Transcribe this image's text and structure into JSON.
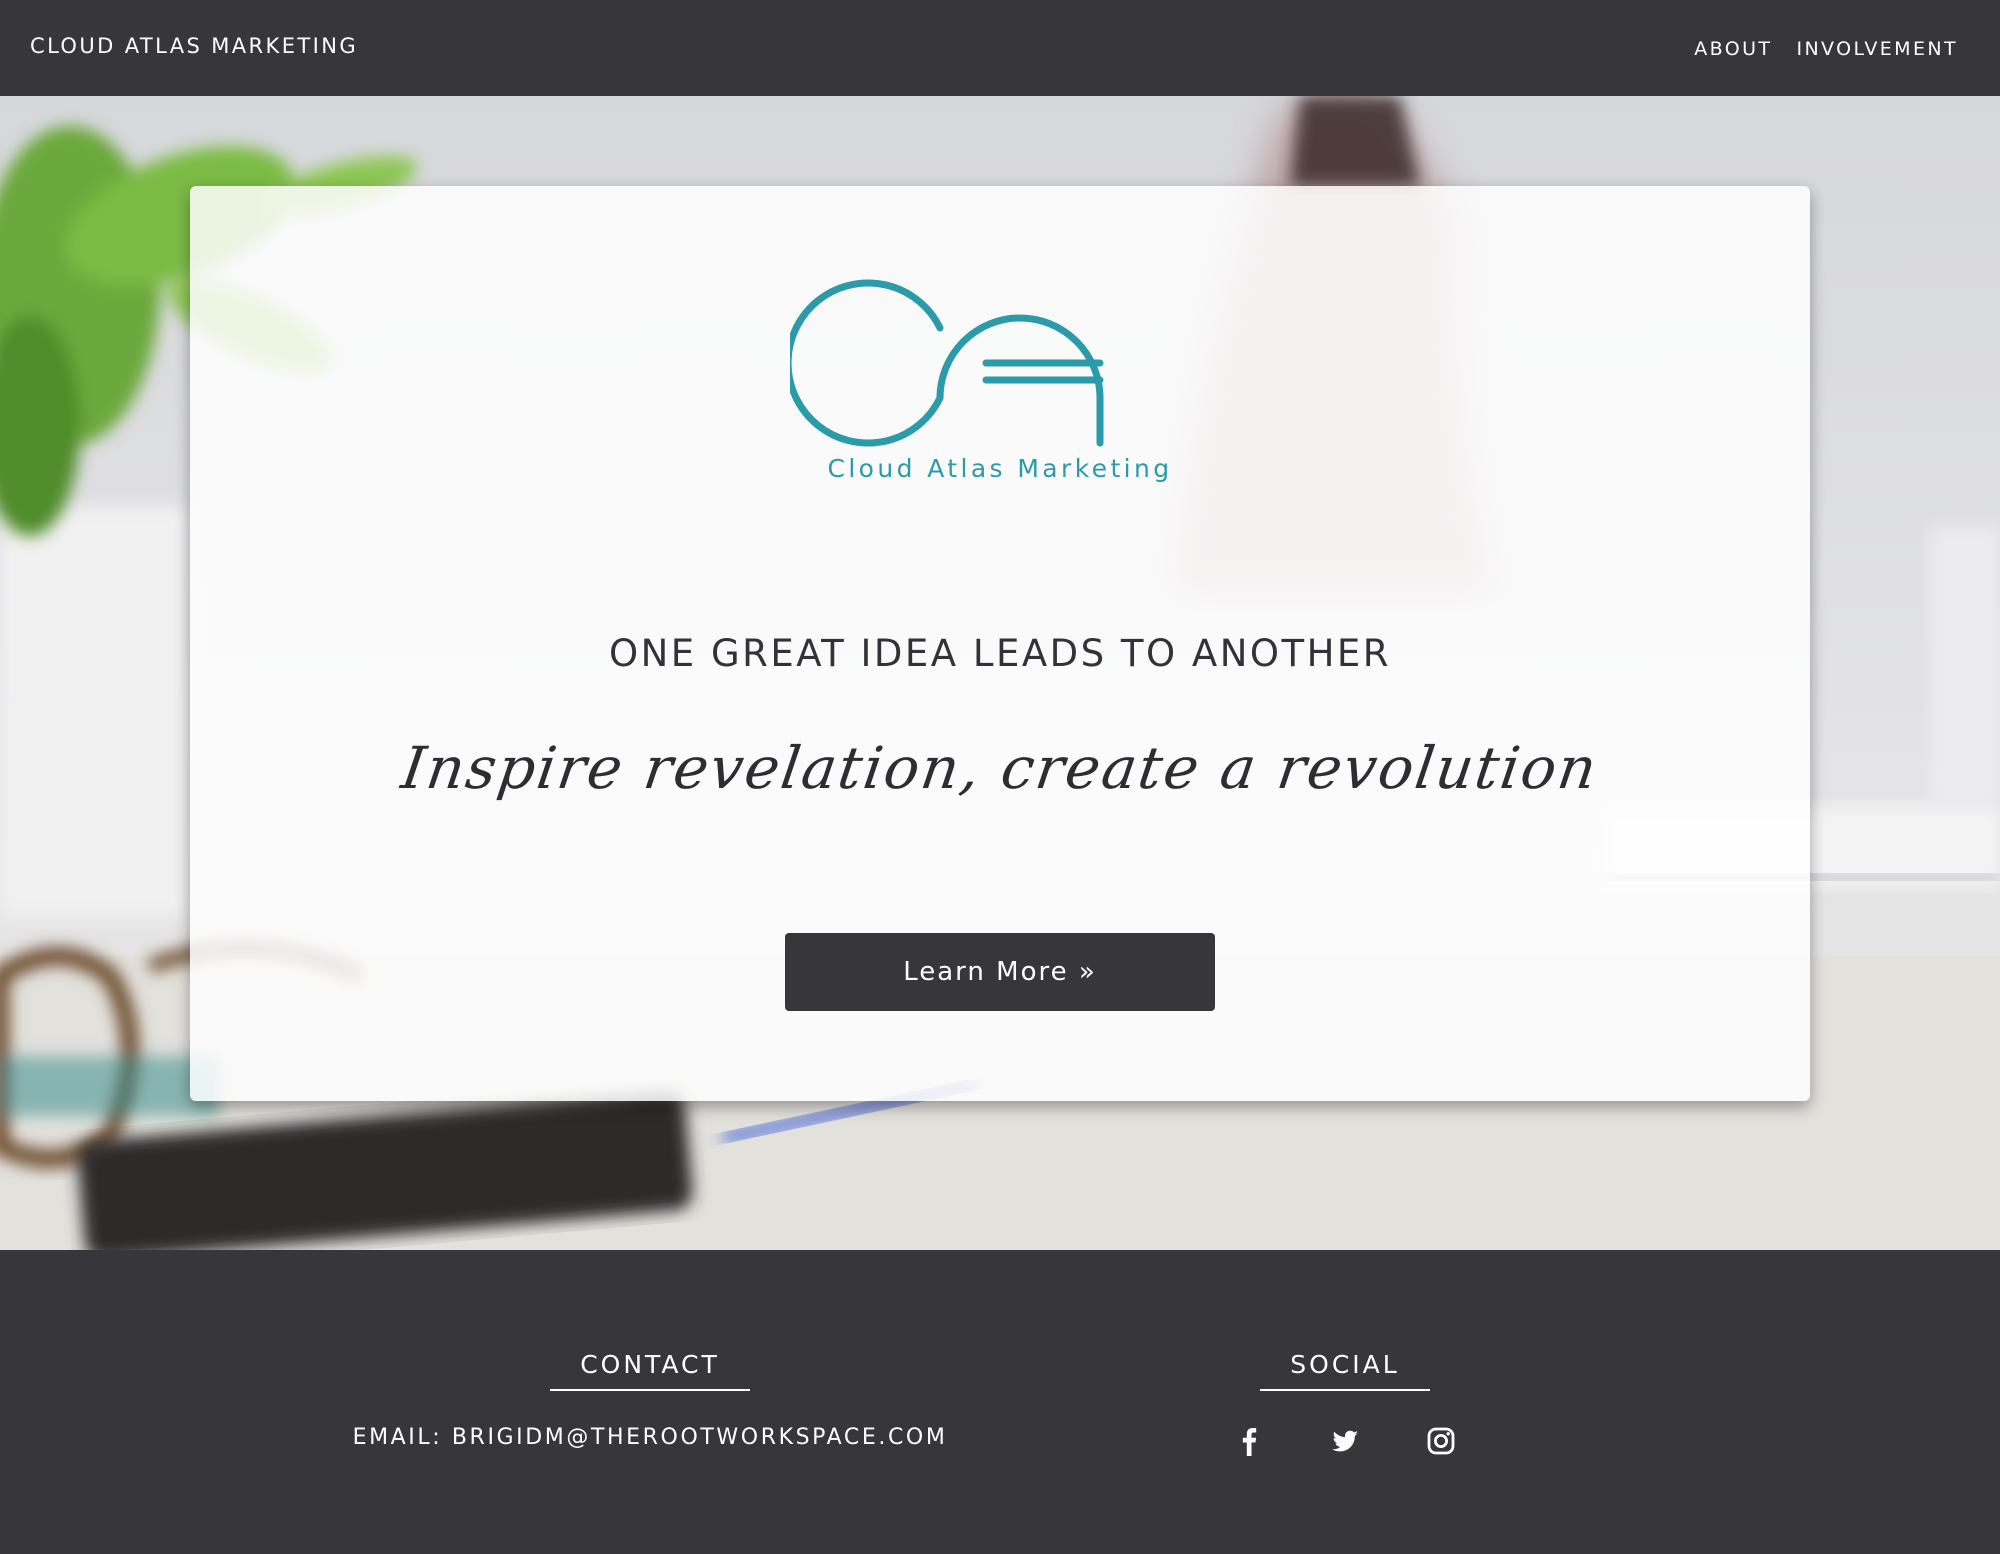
{
  "header": {
    "brand": "CLOUD ATLAS MARKETING",
    "nav": [
      {
        "label": "ABOUT"
      },
      {
        "label": "INVOLVEMENT"
      }
    ]
  },
  "hero": {
    "logo_text": "Cloud Atlas Marketing",
    "headline": "ONE GREAT IDEA LEADS TO ANOTHER",
    "tagline": "Inspire revelation, create a revolution",
    "cta_label": "Learn More »"
  },
  "footer": {
    "contact_heading": "CONTACT",
    "contact_email": "EMAIL: BRIGIDM@THEROOTWORKSPACE.COM",
    "social_heading": "SOCIAL",
    "social_icons": [
      "facebook-icon",
      "twitter-icon",
      "instagram-icon"
    ]
  },
  "colors": {
    "navbar": "#37363b",
    "logo_teal": "#2b9aa9",
    "button": "#37363b",
    "text_dark": "#333236"
  }
}
